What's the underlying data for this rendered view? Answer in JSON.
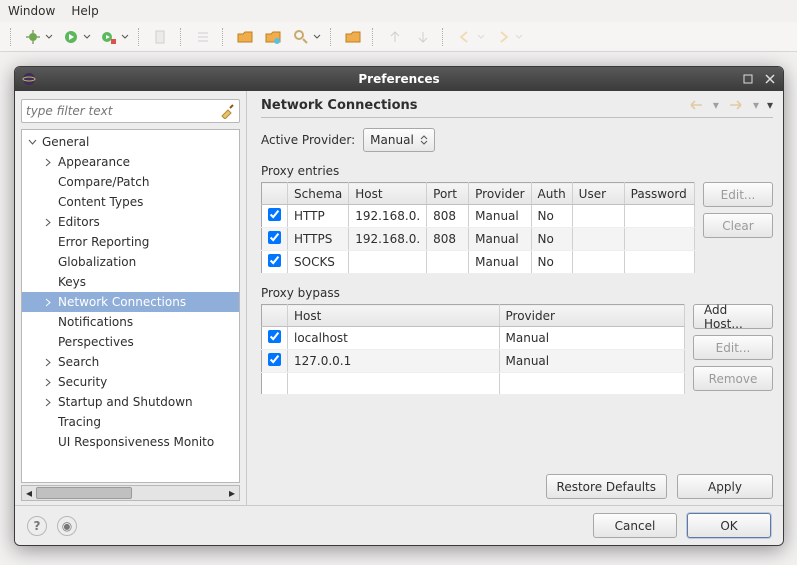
{
  "menubar": {
    "window": "Window",
    "help": "Help"
  },
  "dialog": {
    "title": "Preferences",
    "filter_placeholder": "type filter text",
    "tree": {
      "root": "General",
      "items": [
        {
          "label": "Appearance",
          "expandable": true
        },
        {
          "label": "Compare/Patch",
          "expandable": false
        },
        {
          "label": "Content Types",
          "expandable": false
        },
        {
          "label": "Editors",
          "expandable": true
        },
        {
          "label": "Error Reporting",
          "expandable": false
        },
        {
          "label": "Globalization",
          "expandable": false
        },
        {
          "label": "Keys",
          "expandable": false
        },
        {
          "label": "Network Connections",
          "expandable": true,
          "selected": true
        },
        {
          "label": "Notifications",
          "expandable": false
        },
        {
          "label": "Perspectives",
          "expandable": false
        },
        {
          "label": "Search",
          "expandable": true
        },
        {
          "label": "Security",
          "expandable": true
        },
        {
          "label": "Startup and Shutdown",
          "expandable": true
        },
        {
          "label": "Tracing",
          "expandable": false
        },
        {
          "label": "UI Responsiveness Monito",
          "expandable": false
        }
      ]
    }
  },
  "page": {
    "title": "Network Connections",
    "active_provider_label": "Active Provider:",
    "active_provider_value": "Manual",
    "proxy_entries_label": "Proxy entries",
    "proxy_entries_cols": {
      "schema": "Schema",
      "host": "Host",
      "port": "Port",
      "provider": "Provider",
      "auth": "Auth",
      "user": "User",
      "password": "Password"
    },
    "proxy_entries": [
      {
        "checked": true,
        "schema": "HTTP",
        "host": "192.168.0.",
        "port": "808",
        "provider": "Manual",
        "auth": "No",
        "user": "",
        "password": ""
      },
      {
        "checked": true,
        "schema": "HTTPS",
        "host": "192.168.0.",
        "port": "808",
        "provider": "Manual",
        "auth": "No",
        "user": "",
        "password": ""
      },
      {
        "checked": true,
        "schema": "SOCKS",
        "host": "",
        "port": "",
        "provider": "Manual",
        "auth": "No",
        "user": "",
        "password": ""
      }
    ],
    "proxy_entries_btns": {
      "edit": "Edit...",
      "clear": "Clear"
    },
    "proxy_bypass_label": "Proxy bypass",
    "proxy_bypass_cols": {
      "host": "Host",
      "provider": "Provider"
    },
    "proxy_bypass": [
      {
        "checked": true,
        "host": "localhost",
        "provider": "Manual"
      },
      {
        "checked": true,
        "host": "127.0.0.1",
        "provider": "Manual"
      }
    ],
    "proxy_bypass_btns": {
      "add": "Add Host...",
      "edit": "Edit...",
      "remove": "Remove"
    },
    "restore_defaults": "Restore Defaults",
    "apply": "Apply"
  },
  "buttons": {
    "cancel": "Cancel",
    "ok": "OK",
    "help": "?",
    "record": "◉"
  }
}
